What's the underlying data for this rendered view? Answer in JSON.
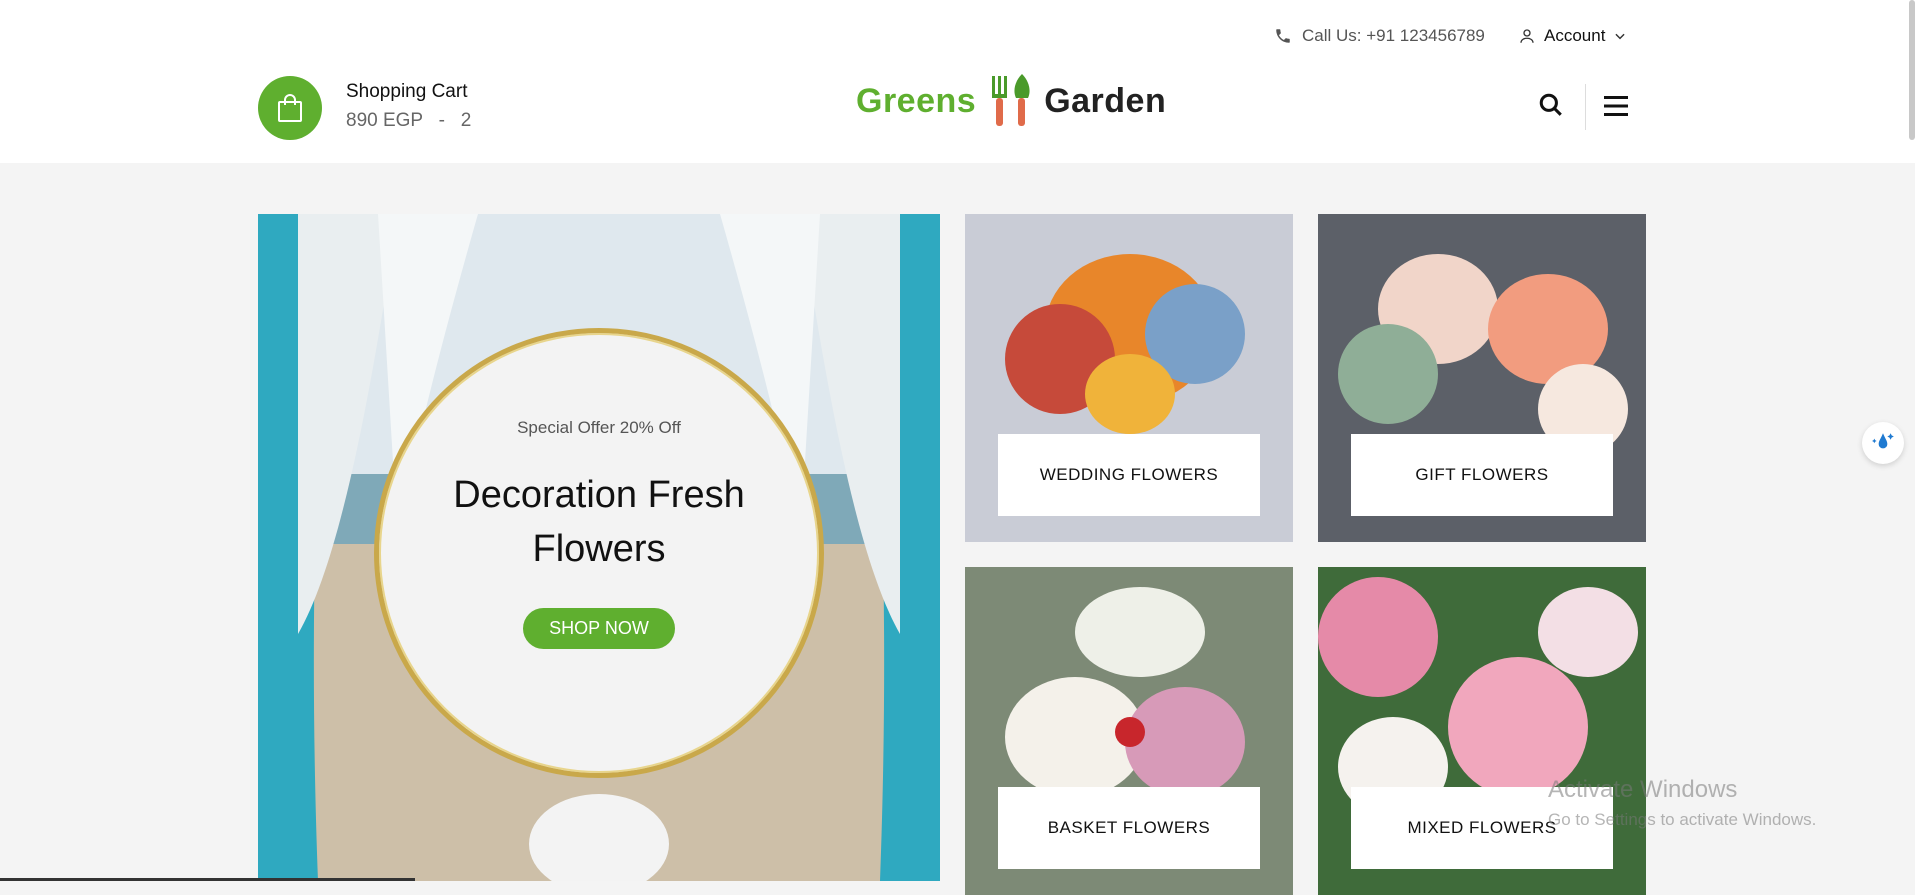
{
  "header": {
    "phone_label": "Call Us: +91 123456789",
    "account_label": "Account",
    "cart": {
      "title": "Shopping Cart",
      "summary": "890 EGP   -   2"
    },
    "logo": {
      "left": "Greens",
      "right": "Garden"
    }
  },
  "hero": {
    "offer": "Special Offer 20% Off",
    "title": "Decoration Fresh Flowers",
    "button": "SHOP NOW"
  },
  "categories": [
    {
      "label": "WEDDING FLOWERS"
    },
    {
      "label": "GIFT FLOWERS"
    },
    {
      "label": "BASKET FLOWERS"
    },
    {
      "label": "MIXED FLOWERS"
    }
  ],
  "watermark": {
    "line1": "Activate Windows",
    "line2": "Go to Settings to activate Windows."
  },
  "colors": {
    "brand_green": "#5faf2f",
    "gold_ring": "#c9a84a"
  },
  "icons": [
    "phone-icon",
    "user-icon",
    "chevron-down-icon",
    "shopping-bag-icon",
    "search-icon",
    "hamburger-menu-icon",
    "sparkle-widget-icon"
  ]
}
